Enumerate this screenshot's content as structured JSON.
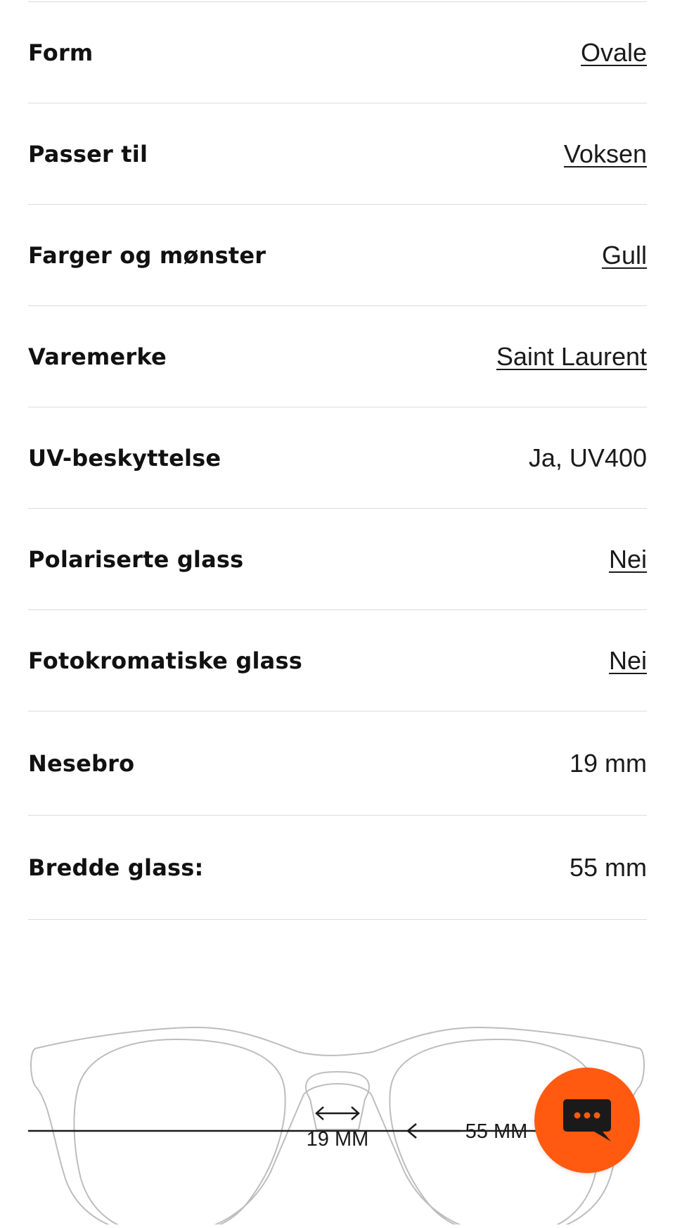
{
  "specs": [
    {
      "label": "Form",
      "value": "Ovale",
      "link": true
    },
    {
      "label": "Passer til",
      "value": "Voksen",
      "link": true
    },
    {
      "label": "Farger og mønster",
      "value": "Gull",
      "link": true
    },
    {
      "label": "Varemerke",
      "value": "Saint Laurent",
      "link": true
    },
    {
      "label": "UV-beskyttelse",
      "value": "Ja, UV400",
      "link": false
    },
    {
      "label": "Polariserte glass",
      "value": "Nei",
      "link": true
    },
    {
      "label": "Fotokromatiske glass",
      "value": "Nei",
      "link": true
    },
    {
      "label": "Nesebro",
      "value": "19 mm",
      "link": false
    },
    {
      "label": "Bredde glass:",
      "value": "55 mm",
      "link": false
    }
  ],
  "diagram": {
    "bridge_label": "19 MM",
    "lens_label": "55 MM"
  },
  "colors": {
    "accent": "#ff5a0f",
    "divider": "#dcdcdc",
    "text": "#1a1a1a"
  },
  "chat": {
    "icon": "chat-bubble-icon"
  }
}
